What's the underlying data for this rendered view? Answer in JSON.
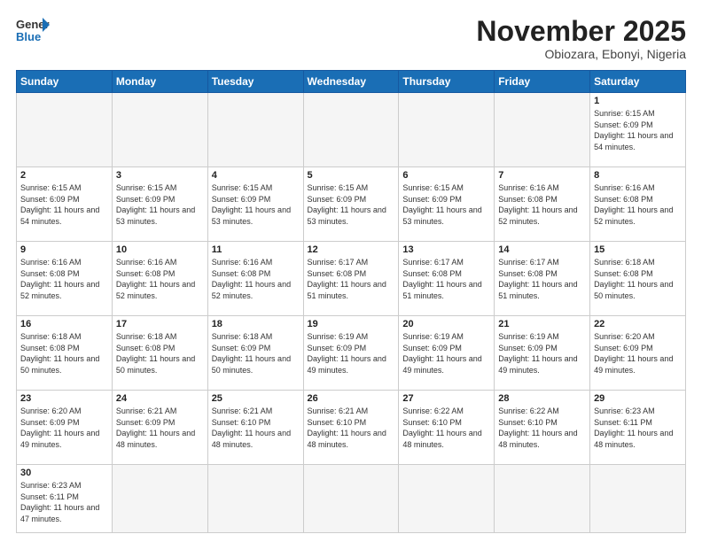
{
  "header": {
    "logo_general": "General",
    "logo_blue": "Blue",
    "month_title": "November 2025",
    "subtitle": "Obiozara, Ebonyi, Nigeria"
  },
  "days_of_week": [
    "Sunday",
    "Monday",
    "Tuesday",
    "Wednesday",
    "Thursday",
    "Friday",
    "Saturday"
  ],
  "weeks": [
    [
      {
        "day": "",
        "info": ""
      },
      {
        "day": "",
        "info": ""
      },
      {
        "day": "",
        "info": ""
      },
      {
        "day": "",
        "info": ""
      },
      {
        "day": "",
        "info": ""
      },
      {
        "day": "",
        "info": ""
      },
      {
        "day": "1",
        "info": "Sunrise: 6:15 AM\nSunset: 6:09 PM\nDaylight: 11 hours\nand 54 minutes."
      }
    ],
    [
      {
        "day": "2",
        "info": "Sunrise: 6:15 AM\nSunset: 6:09 PM\nDaylight: 11 hours\nand 54 minutes."
      },
      {
        "day": "3",
        "info": "Sunrise: 6:15 AM\nSunset: 6:09 PM\nDaylight: 11 hours\nand 53 minutes."
      },
      {
        "day": "4",
        "info": "Sunrise: 6:15 AM\nSunset: 6:09 PM\nDaylight: 11 hours\nand 53 minutes."
      },
      {
        "day": "5",
        "info": "Sunrise: 6:15 AM\nSunset: 6:09 PM\nDaylight: 11 hours\nand 53 minutes."
      },
      {
        "day": "6",
        "info": "Sunrise: 6:15 AM\nSunset: 6:09 PM\nDaylight: 11 hours\nand 53 minutes."
      },
      {
        "day": "7",
        "info": "Sunrise: 6:16 AM\nSunset: 6:08 PM\nDaylight: 11 hours\nand 52 minutes."
      },
      {
        "day": "8",
        "info": "Sunrise: 6:16 AM\nSunset: 6:08 PM\nDaylight: 11 hours\nand 52 minutes."
      }
    ],
    [
      {
        "day": "9",
        "info": "Sunrise: 6:16 AM\nSunset: 6:08 PM\nDaylight: 11 hours\nand 52 minutes."
      },
      {
        "day": "10",
        "info": "Sunrise: 6:16 AM\nSunset: 6:08 PM\nDaylight: 11 hours\nand 52 minutes."
      },
      {
        "day": "11",
        "info": "Sunrise: 6:16 AM\nSunset: 6:08 PM\nDaylight: 11 hours\nand 52 minutes."
      },
      {
        "day": "12",
        "info": "Sunrise: 6:17 AM\nSunset: 6:08 PM\nDaylight: 11 hours\nand 51 minutes."
      },
      {
        "day": "13",
        "info": "Sunrise: 6:17 AM\nSunset: 6:08 PM\nDaylight: 11 hours\nand 51 minutes."
      },
      {
        "day": "14",
        "info": "Sunrise: 6:17 AM\nSunset: 6:08 PM\nDaylight: 11 hours\nand 51 minutes."
      },
      {
        "day": "15",
        "info": "Sunrise: 6:18 AM\nSunset: 6:08 PM\nDaylight: 11 hours\nand 50 minutes."
      }
    ],
    [
      {
        "day": "16",
        "info": "Sunrise: 6:18 AM\nSunset: 6:08 PM\nDaylight: 11 hours\nand 50 minutes."
      },
      {
        "day": "17",
        "info": "Sunrise: 6:18 AM\nSunset: 6:08 PM\nDaylight: 11 hours\nand 50 minutes."
      },
      {
        "day": "18",
        "info": "Sunrise: 6:18 AM\nSunset: 6:09 PM\nDaylight: 11 hours\nand 50 minutes."
      },
      {
        "day": "19",
        "info": "Sunrise: 6:19 AM\nSunset: 6:09 PM\nDaylight: 11 hours\nand 49 minutes."
      },
      {
        "day": "20",
        "info": "Sunrise: 6:19 AM\nSunset: 6:09 PM\nDaylight: 11 hours\nand 49 minutes."
      },
      {
        "day": "21",
        "info": "Sunrise: 6:19 AM\nSunset: 6:09 PM\nDaylight: 11 hours\nand 49 minutes."
      },
      {
        "day": "22",
        "info": "Sunrise: 6:20 AM\nSunset: 6:09 PM\nDaylight: 11 hours\nand 49 minutes."
      }
    ],
    [
      {
        "day": "23",
        "info": "Sunrise: 6:20 AM\nSunset: 6:09 PM\nDaylight: 11 hours\nand 49 minutes."
      },
      {
        "day": "24",
        "info": "Sunrise: 6:21 AM\nSunset: 6:09 PM\nDaylight: 11 hours\nand 48 minutes."
      },
      {
        "day": "25",
        "info": "Sunrise: 6:21 AM\nSunset: 6:10 PM\nDaylight: 11 hours\nand 48 minutes."
      },
      {
        "day": "26",
        "info": "Sunrise: 6:21 AM\nSunset: 6:10 PM\nDaylight: 11 hours\nand 48 minutes."
      },
      {
        "day": "27",
        "info": "Sunrise: 6:22 AM\nSunset: 6:10 PM\nDaylight: 11 hours\nand 48 minutes."
      },
      {
        "day": "28",
        "info": "Sunrise: 6:22 AM\nSunset: 6:10 PM\nDaylight: 11 hours\nand 48 minutes."
      },
      {
        "day": "29",
        "info": "Sunrise: 6:23 AM\nSunset: 6:11 PM\nDaylight: 11 hours\nand 48 minutes."
      }
    ],
    [
      {
        "day": "30",
        "info": "Sunrise: 6:23 AM\nSunset: 6:11 PM\nDaylight: 11 hours\nand 47 minutes."
      },
      {
        "day": "",
        "info": ""
      },
      {
        "day": "",
        "info": ""
      },
      {
        "day": "",
        "info": ""
      },
      {
        "day": "",
        "info": ""
      },
      {
        "day": "",
        "info": ""
      },
      {
        "day": "",
        "info": ""
      }
    ]
  ]
}
